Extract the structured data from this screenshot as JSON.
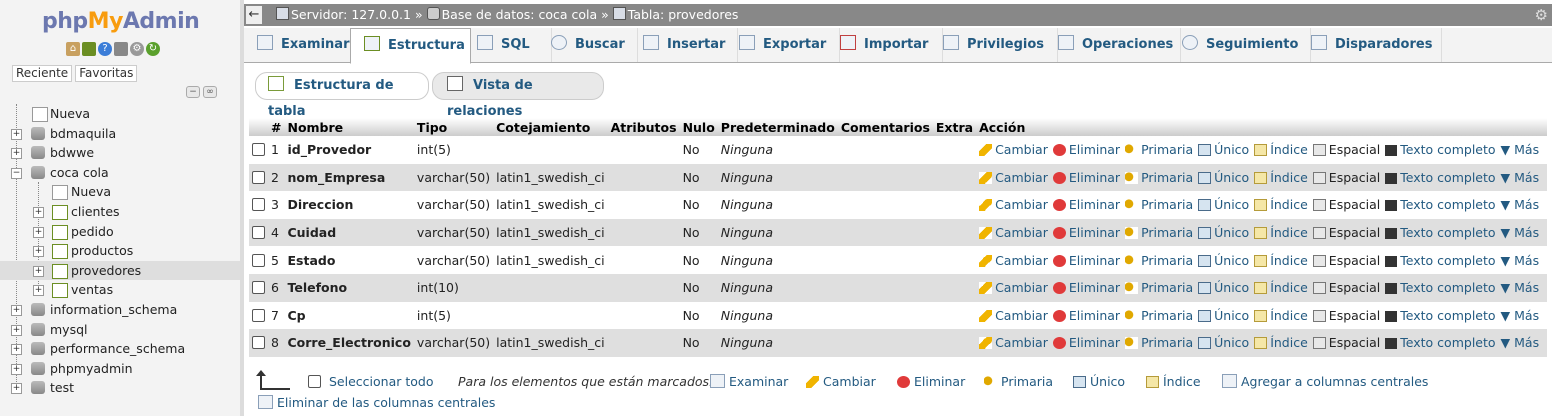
{
  "left": {
    "logo": {
      "php": "php",
      "my": "My",
      "admin": "Admin"
    },
    "tabs": [
      "Reciente",
      "Favoritas"
    ],
    "tree": [
      {
        "label": "Nueva",
        "level": 0,
        "type": "new"
      },
      {
        "label": "bdmaquila",
        "level": 0,
        "type": "db"
      },
      {
        "label": "bdwwe",
        "level": 0,
        "type": "db"
      },
      {
        "label": "coca cola",
        "level": 0,
        "type": "db",
        "expanded": true
      },
      {
        "label": "Nueva",
        "level": 1,
        "type": "new"
      },
      {
        "label": "clientes",
        "level": 1,
        "type": "table"
      },
      {
        "label": "pedido",
        "level": 1,
        "type": "table"
      },
      {
        "label": "productos",
        "level": 1,
        "type": "table"
      },
      {
        "label": "provedores",
        "level": 1,
        "type": "table",
        "selected": true
      },
      {
        "label": "ventas",
        "level": 1,
        "type": "table"
      },
      {
        "label": "information_schema",
        "level": 0,
        "type": "db"
      },
      {
        "label": "mysql",
        "level": 0,
        "type": "db"
      },
      {
        "label": "performance_schema",
        "level": 0,
        "type": "db"
      },
      {
        "label": "phpmyadmin",
        "level": 0,
        "type": "db"
      },
      {
        "label": "test",
        "level": 0,
        "type": "db"
      }
    ]
  },
  "breadcrumb": {
    "server": "Servidor: 127.0.0.1",
    "sep1": "»",
    "database": "Base de datos: coca cola",
    "sep2": "»",
    "table": "Tabla: provedores"
  },
  "tabs": [
    "Examinar",
    "Estructura",
    "SQL",
    "Buscar",
    "Insertar",
    "Exportar",
    "Importar",
    "Privilegios",
    "Operaciones",
    "Seguimiento",
    "Disparadores"
  ],
  "active_tab": "Estructura",
  "subtabs": [
    "Estructura de tabla",
    "Vista de relaciones"
  ],
  "table": {
    "headers": [
      "#",
      "Nombre",
      "Tipo",
      "Cotejamiento",
      "Atributos",
      "Nulo",
      "Predeterminado",
      "Comentarios",
      "Extra",
      "Acción"
    ],
    "rows": [
      {
        "n": "1",
        "name": "id_Provedor",
        "type": "int(5)",
        "collation": "",
        "null": "No",
        "default": "Ninguna"
      },
      {
        "n": "2",
        "name": "nom_Empresa",
        "type": "varchar(50)",
        "collation": "latin1_swedish_ci",
        "null": "No",
        "default": "Ninguna"
      },
      {
        "n": "3",
        "name": "Direccion",
        "type": "varchar(50)",
        "collation": "latin1_swedish_ci",
        "null": "No",
        "default": "Ninguna"
      },
      {
        "n": "4",
        "name": "Cuidad",
        "type": "varchar(50)",
        "collation": "latin1_swedish_ci",
        "null": "No",
        "default": "Ninguna"
      },
      {
        "n": "5",
        "name": "Estado",
        "type": "varchar(50)",
        "collation": "latin1_swedish_ci",
        "null": "No",
        "default": "Ninguna"
      },
      {
        "n": "6",
        "name": "Telefono",
        "type": "int(10)",
        "collation": "",
        "null": "No",
        "default": "Ninguna"
      },
      {
        "n": "7",
        "name": "Cp",
        "type": "int(5)",
        "collation": "",
        "null": "No",
        "default": "Ninguna"
      },
      {
        "n": "8",
        "name": "Corre_Electronico",
        "type": "varchar(50)",
        "collation": "latin1_swedish_ci",
        "null": "No",
        "default": "Ninguna"
      }
    ],
    "actions": {
      "change": "Cambiar",
      "drop": "Eliminar",
      "primary": "Primaria",
      "unique": "Único",
      "index": "Índice",
      "spatial": "Espacial",
      "fulltext": "Texto completo",
      "more": "Más"
    }
  },
  "footer": {
    "select_all": "Seleccionar todo",
    "with_selected": "Para los elementos que están marcados:",
    "browse": "Examinar",
    "change": "Cambiar",
    "drop": "Eliminar",
    "primary": "Primaria",
    "unique": "Único",
    "index": "Índice",
    "add_central": "Agregar a columnas centrales",
    "remove_central": "Eliminar de las columnas centrales"
  },
  "colors": {
    "link": "#235a81",
    "topbar": "#888888",
    "row_alt": "#dfdfdf"
  }
}
